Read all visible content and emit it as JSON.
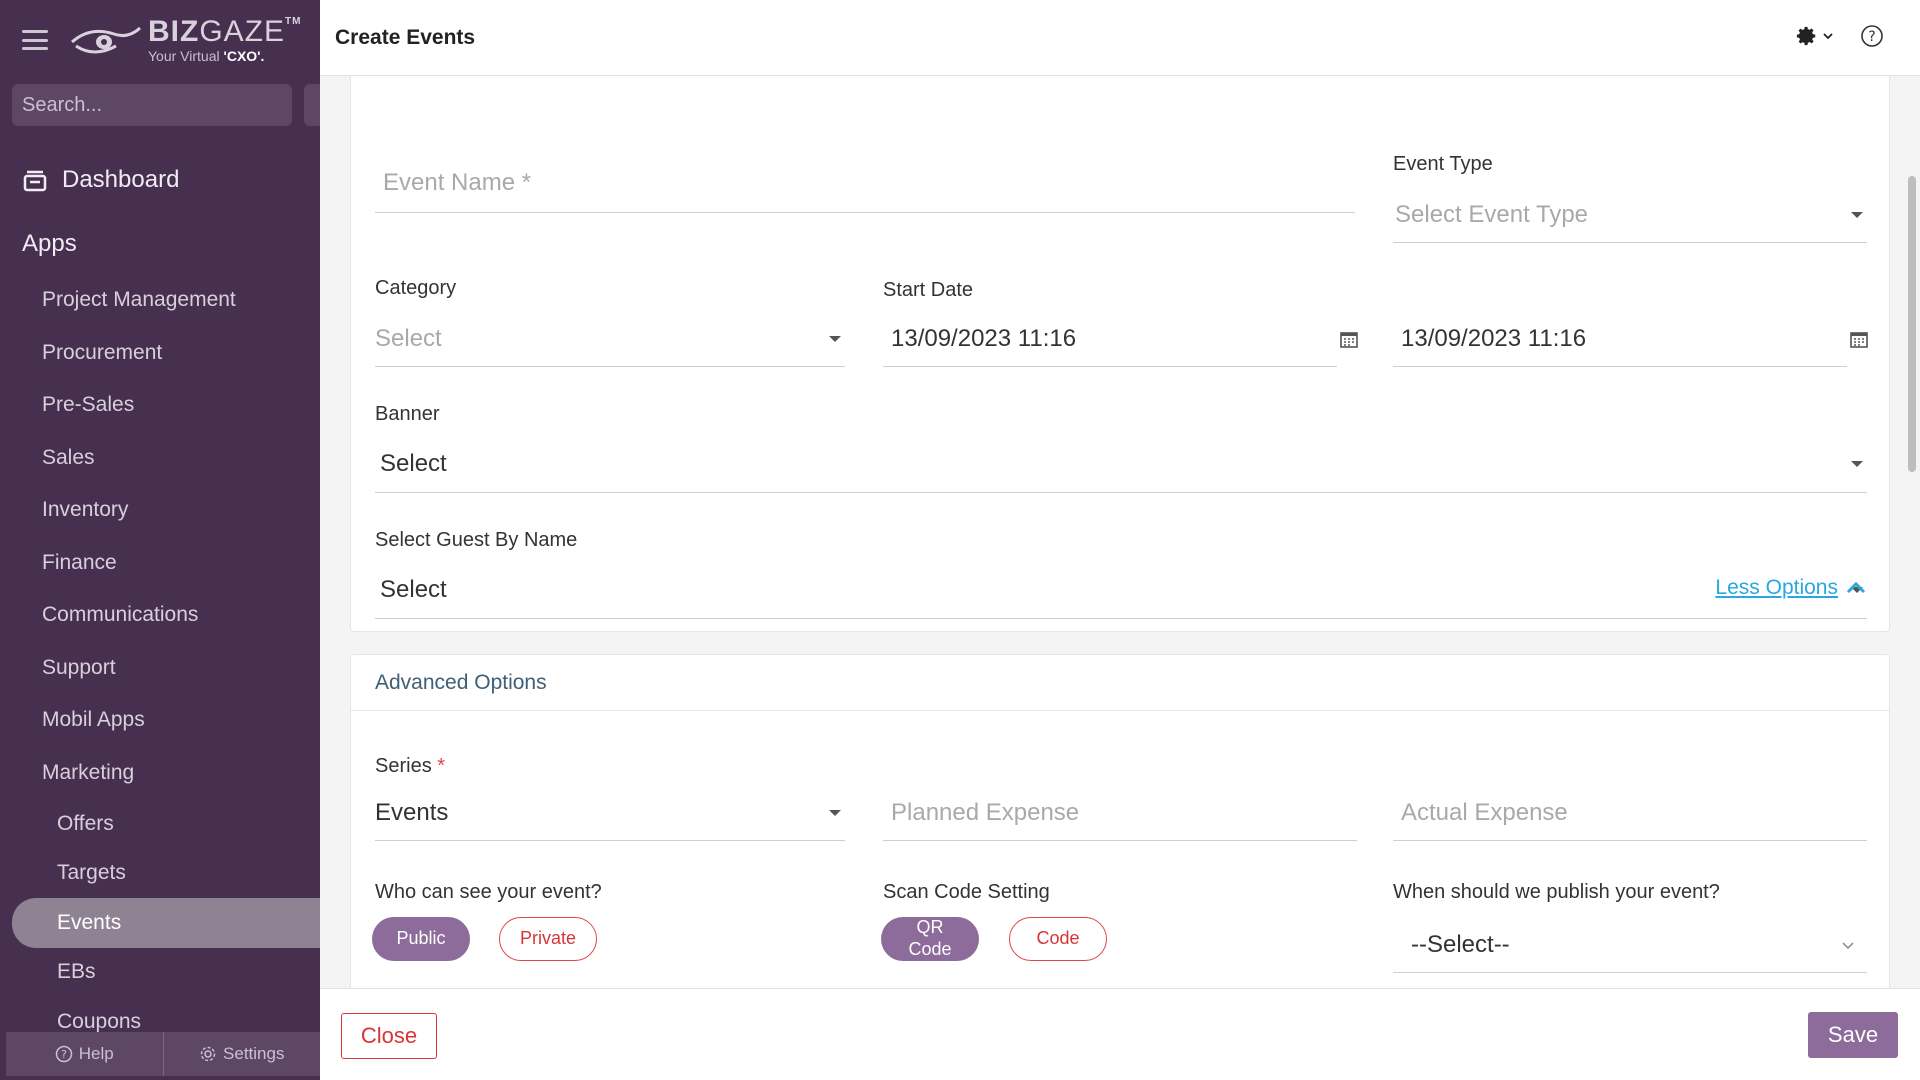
{
  "sidebar": {
    "logo": {
      "brand": "BIZ GAZE",
      "brand_bold": "BIZ",
      "brand_thin": "GAZE",
      "tm": "TM",
      "tagline_pre": "Your Virtual ",
      "tagline_bold": "'CXO'."
    },
    "search_placeholder": "Search...",
    "dashboard_label": "Dashboard",
    "apps_label": "Apps",
    "items": [
      {
        "label": "Project Management"
      },
      {
        "label": "Procurement"
      },
      {
        "label": "Pre-Sales"
      },
      {
        "label": "Sales"
      },
      {
        "label": "Inventory"
      },
      {
        "label": "Finance"
      },
      {
        "label": "Communications"
      },
      {
        "label": "Support"
      },
      {
        "label": "Mobil Apps"
      },
      {
        "label": "Marketing"
      }
    ],
    "subitems": [
      {
        "label": "Offers"
      },
      {
        "label": "Targets"
      },
      {
        "label": "Events",
        "active": true
      },
      {
        "label": "EBs"
      },
      {
        "label": "Coupons"
      }
    ],
    "bottom": {
      "help": "Help",
      "settings": "Settings"
    }
  },
  "modal": {
    "title": "Create Events",
    "form": {
      "event_name_placeholder": "Event Name *",
      "event_type_label": "Event Type",
      "event_type_placeholder": "Select Event Type",
      "category_label": "Category",
      "category_value": "Select",
      "start_date_label": "Start Date",
      "start_date_value": "13/09/2023 11:16",
      "end_date_value": "13/09/2023 11:16",
      "banner_label": "Banner",
      "banner_value": "Select",
      "guest_label": "Select Guest By Name",
      "guest_value": "Select",
      "less_options": "Less Options"
    },
    "advanced": {
      "title": "Advanced Options",
      "series_label": "Series",
      "series_required": "*",
      "series_value": "Events",
      "planned_expense_placeholder": "Planned Expense",
      "actual_expense_placeholder": "Actual Expense",
      "visibility_label": "Who can see your event?",
      "visibility_public": "Public",
      "visibility_private": "Private",
      "scan_label": "Scan Code Setting",
      "scan_qr": "QR Code",
      "scan_code": "Code",
      "publish_label": "When should we publish your event?",
      "publish_value": "--Select--"
    },
    "footer": {
      "close": "Close",
      "save": "Save"
    }
  },
  "colors": {
    "sidebar_bg": "#47304f",
    "accent": "#8d6b9b",
    "danger": "#d83434",
    "link": "#2aa7df"
  }
}
